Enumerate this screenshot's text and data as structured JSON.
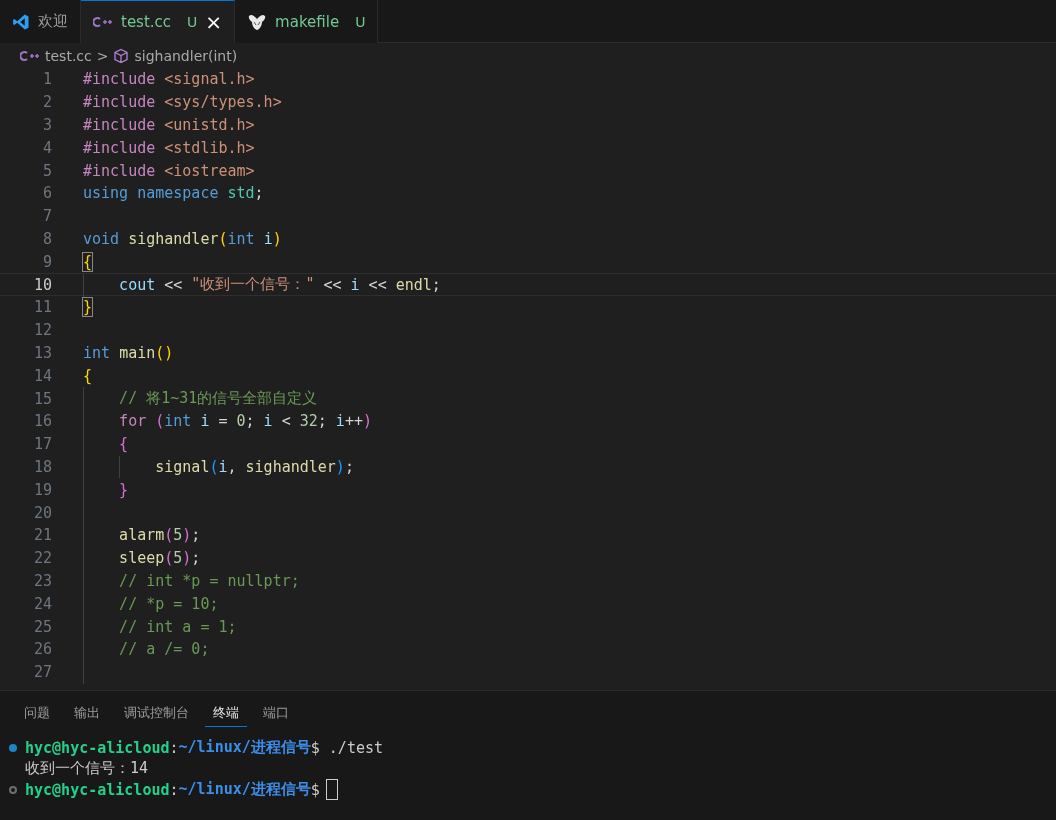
{
  "tabs": [
    {
      "kind": "vscode",
      "label": "欢迎",
      "selected": false
    },
    {
      "kind": "cpp",
      "label": "test.cc",
      "badge": "U",
      "close": "×",
      "selected": true
    },
    {
      "kind": "gnu",
      "label": "makefile",
      "badge": "U",
      "selected": false
    }
  ],
  "breadcrumb": {
    "file": "test.cc",
    "separator": ">",
    "symbol": "sighandler(int)"
  },
  "editor": {
    "lines": [
      {
        "number": "1",
        "selected": false,
        "tokens": [
          {
            "t": "#include ",
            "kind": "pre"
          },
          {
            "t": "<signal.h>",
            "kind": "str"
          }
        ]
      },
      {
        "number": "2",
        "selected": false,
        "tokens": [
          {
            "t": "#include ",
            "kind": "pre"
          },
          {
            "t": "<sys/types.h>",
            "kind": "str"
          }
        ]
      },
      {
        "number": "3",
        "selected": false,
        "tokens": [
          {
            "t": "#include ",
            "kind": "pre"
          },
          {
            "t": "<unistd.h>",
            "kind": "str"
          }
        ]
      },
      {
        "number": "4",
        "selected": false,
        "tokens": [
          {
            "t": "#include ",
            "kind": "pre"
          },
          {
            "t": "<stdlib.h>",
            "kind": "str"
          }
        ]
      },
      {
        "number": "5",
        "selected": false,
        "tokens": [
          {
            "t": "#include ",
            "kind": "pre"
          },
          {
            "t": "<iostream>",
            "kind": "str"
          }
        ]
      },
      {
        "number": "6",
        "selected": false,
        "tokens": [
          {
            "t": "using ",
            "kind": "kw"
          },
          {
            "t": "namespace ",
            "kind": "kw"
          },
          {
            "t": "std",
            "kind": "type"
          },
          {
            "t": ";",
            "kind": "op"
          }
        ]
      },
      {
        "number": "7",
        "selected": false
      },
      {
        "number": "8",
        "selected": false,
        "tokens": [
          {
            "t": "void ",
            "kind": "kw"
          },
          {
            "t": "sighandler",
            "kind": "fn"
          },
          {
            "t": "(",
            "kind": "b1"
          },
          {
            "t": "int ",
            "kind": "kw"
          },
          {
            "t": "i",
            "kind": "var"
          },
          {
            "t": ")",
            "kind": "b1"
          }
        ]
      },
      {
        "number": "9",
        "selected": false,
        "tokens": [
          {
            "t": "{",
            "kind": "b1-match"
          }
        ]
      },
      {
        "number": "10",
        "selected": true,
        "tokens": [
          {
            "t": "    cout ",
            "kind": "var"
          },
          {
            "t": "<< ",
            "kind": "op"
          },
          {
            "t": "\"收到一个信号：\" ",
            "kind": "str"
          },
          {
            "t": "<< ",
            "kind": "op"
          },
          {
            "t": "i ",
            "kind": "var"
          },
          {
            "t": "<< ",
            "kind": "op"
          },
          {
            "t": "endl",
            "kind": "fn"
          },
          {
            "t": ";",
            "kind": "op"
          }
        ]
      },
      {
        "number": "11",
        "selected": false,
        "tokens": [
          {
            "t": "}",
            "kind": "b1-match"
          }
        ]
      },
      {
        "number": "12",
        "selected": false
      },
      {
        "number": "13",
        "selected": false,
        "tokens": [
          {
            "t": "int ",
            "kind": "kw"
          },
          {
            "t": "main",
            "kind": "fn"
          },
          {
            "t": "()",
            "kind": "b1"
          }
        ]
      },
      {
        "number": "14",
        "selected": false,
        "tokens": [
          {
            "t": "{",
            "kind": "b1"
          }
        ]
      },
      {
        "number": "15",
        "selected": false,
        "tokens": [
          {
            "t": "    // 将1~31的信号全部自定义",
            "kind": "cmt"
          }
        ]
      },
      {
        "number": "16",
        "selected": false,
        "tokens": [
          {
            "t": "    for ",
            "kind": "ctl"
          },
          {
            "t": "(",
            "kind": "b2"
          },
          {
            "t": "int ",
            "kind": "kw"
          },
          {
            "t": "i ",
            "kind": "var"
          },
          {
            "t": "= ",
            "kind": "op"
          },
          {
            "t": "0",
            "kind": "num"
          },
          {
            "t": "; ",
            "kind": "op"
          },
          {
            "t": "i ",
            "kind": "var"
          },
          {
            "t": "< ",
            "kind": "op"
          },
          {
            "t": "32",
            "kind": "num"
          },
          {
            "t": "; ",
            "kind": "op"
          },
          {
            "t": "i",
            "kind": "var"
          },
          {
            "t": "++",
            "kind": "op"
          },
          {
            "t": ")",
            "kind": "b2"
          }
        ]
      },
      {
        "number": "17",
        "selected": false,
        "tokens": [
          {
            "t": "    {",
            "kind": "b2"
          }
        ]
      },
      {
        "number": "18",
        "selected": false,
        "tokens": [
          {
            "t": "        signal",
            "kind": "fn"
          },
          {
            "t": "(",
            "kind": "b3"
          },
          {
            "t": "i",
            "kind": "var"
          },
          {
            "t": ", ",
            "kind": "op"
          },
          {
            "t": "sighandler",
            "kind": "fn"
          },
          {
            "t": ")",
            "kind": "b3"
          },
          {
            "t": ";",
            "kind": "op"
          }
        ]
      },
      {
        "number": "19",
        "selected": false,
        "tokens": [
          {
            "t": "    }",
            "kind": "b2"
          }
        ]
      },
      {
        "number": "20",
        "selected": false
      },
      {
        "number": "21",
        "selected": false,
        "tokens": [
          {
            "t": "    alarm",
            "kind": "fn"
          },
          {
            "t": "(",
            "kind": "b2"
          },
          {
            "t": "5",
            "kind": "num"
          },
          {
            "t": ")",
            "kind": "b2"
          },
          {
            "t": ";",
            "kind": "op"
          }
        ]
      },
      {
        "number": "22",
        "selected": false,
        "tokens": [
          {
            "t": "    sleep",
            "kind": "fn"
          },
          {
            "t": "(",
            "kind": "b2"
          },
          {
            "t": "5",
            "kind": "num"
          },
          {
            "t": ")",
            "kind": "b2"
          },
          {
            "t": ";",
            "kind": "op"
          }
        ]
      },
      {
        "number": "23",
        "selected": false,
        "tokens": [
          {
            "t": "    // int *p = nullptr;",
            "kind": "cmt"
          }
        ]
      },
      {
        "number": "24",
        "selected": false,
        "tokens": [
          {
            "t": "    // *p = 10;",
            "kind": "cmt"
          }
        ]
      },
      {
        "number": "25",
        "selected": false,
        "tokens": [
          {
            "t": "    // int a = 1;",
            "kind": "cmt"
          }
        ]
      },
      {
        "number": "26",
        "selected": false,
        "tokens": [
          {
            "t": "    // a /= 0;",
            "kind": "cmt"
          }
        ]
      },
      {
        "number": "27",
        "selected": false
      }
    ]
  },
  "panel": {
    "tabs": [
      {
        "label": "问题",
        "selected": false
      },
      {
        "label": "输出",
        "selected": false
      },
      {
        "label": "调试控制台",
        "selected": false
      },
      {
        "label": "终端",
        "selected": true
      },
      {
        "label": "端口",
        "selected": false
      }
    ],
    "terminal": [
      {
        "kind": "prompt",
        "finished": true,
        "user": "hyc@hyc-alicloud",
        "colon": ":",
        "path": "~/linux/进程信号",
        "dollar": "$",
        "command": "./test"
      },
      {
        "kind": "output",
        "text": "收到一个信号：14"
      },
      {
        "kind": "prompt",
        "finished": false,
        "user": "hyc@hyc-alicloud",
        "colon": ":",
        "path": "~/linux/进程信号",
        "dollar": "$",
        "cursor": true
      }
    ]
  }
}
